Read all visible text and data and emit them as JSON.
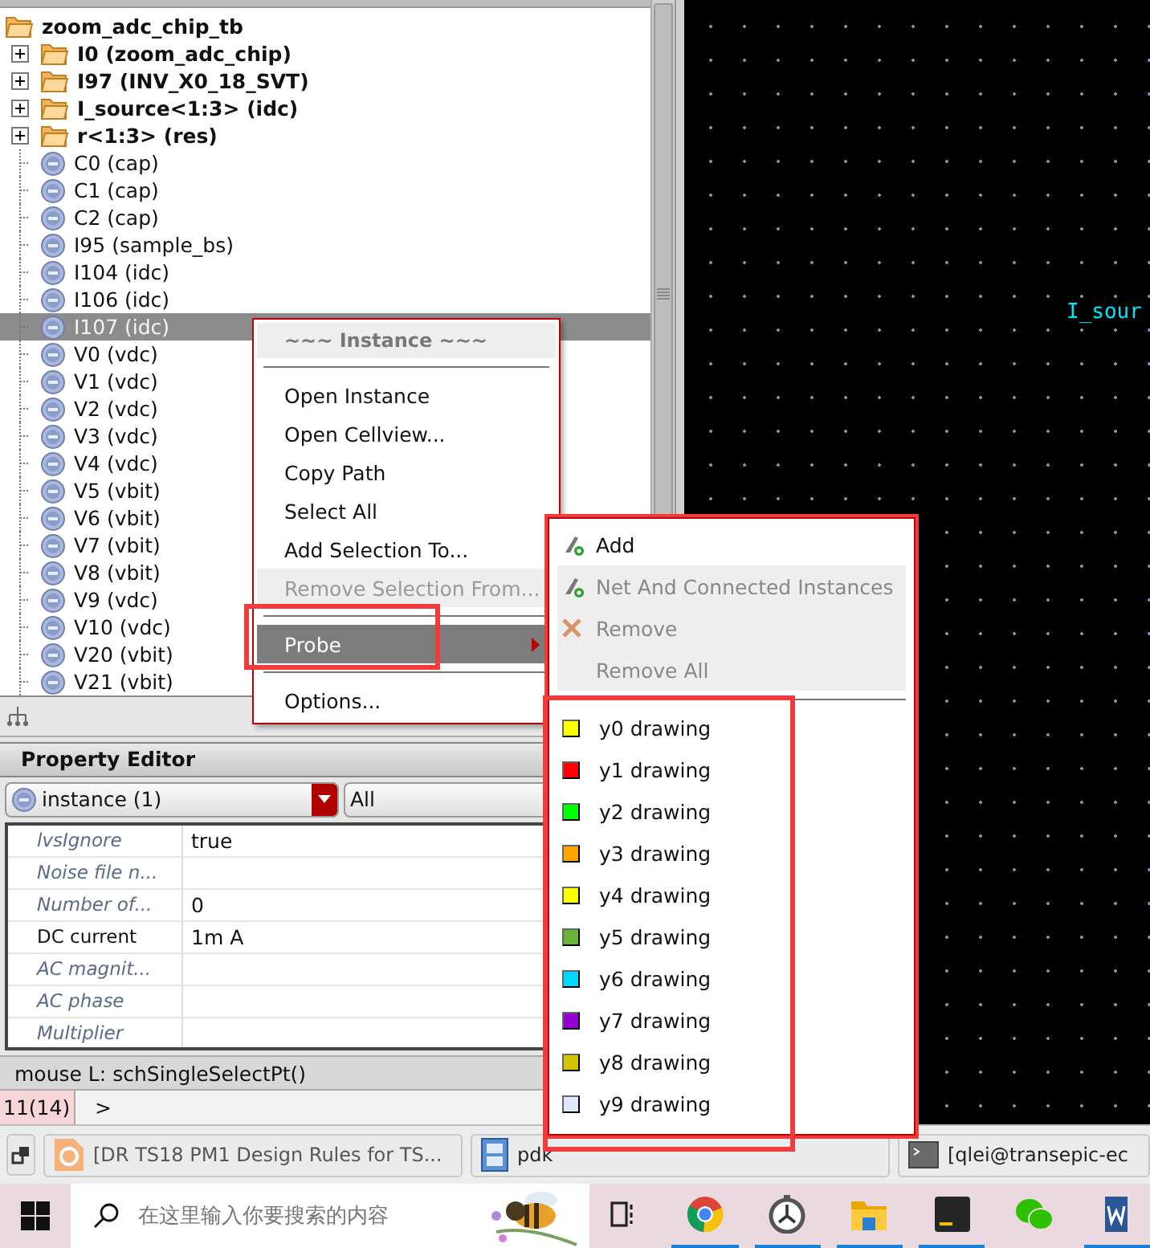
{
  "tree": {
    "root": {
      "label": "zoom_adc_chip_tb",
      "expanded": true,
      "selected": false,
      "children": [
        {
          "label": "I0 (zoom_adc_chip)",
          "kind": "folder",
          "expanded": false,
          "selected": false
        },
        {
          "label": "I97 (INV_X0_18_SVT)",
          "kind": "folder",
          "expanded": false,
          "selected": false
        },
        {
          "label": "I_source<1:3> (idc)",
          "kind": "folder",
          "expanded": false,
          "selected": false
        },
        {
          "label": "r<1:3> (res)",
          "kind": "folder",
          "expanded": false,
          "selected": false
        },
        {
          "label": "C0 (cap)",
          "kind": "instance",
          "selected": false
        },
        {
          "label": "C1 (cap)",
          "kind": "instance",
          "selected": false
        },
        {
          "label": "C2 (cap)",
          "kind": "instance",
          "selected": false
        },
        {
          "label": "I95 (sample_bs)",
          "kind": "instance",
          "selected": false
        },
        {
          "label": "I104 (idc)",
          "kind": "instance",
          "selected": false
        },
        {
          "label": "I106 (idc)",
          "kind": "instance",
          "selected": false
        },
        {
          "label": "I107 (idc)",
          "kind": "instance",
          "selected": true
        },
        {
          "label": "V0 (vdc)",
          "kind": "instance",
          "selected": false
        },
        {
          "label": "V1 (vdc)",
          "kind": "instance",
          "selected": false
        },
        {
          "label": "V2 (vdc)",
          "kind": "instance",
          "selected": false
        },
        {
          "label": "V3 (vdc)",
          "kind": "instance",
          "selected": false
        },
        {
          "label": "V4 (vdc)",
          "kind": "instance",
          "selected": false
        },
        {
          "label": "V5 (vbit)",
          "kind": "instance",
          "selected": false
        },
        {
          "label": "V6 (vbit)",
          "kind": "instance",
          "selected": false
        },
        {
          "label": "V7 (vbit)",
          "kind": "instance",
          "selected": false
        },
        {
          "label": "V8 (vbit)",
          "kind": "instance",
          "selected": false
        },
        {
          "label": "V9 (vdc)",
          "kind": "instance",
          "selected": false
        },
        {
          "label": "V10 (vdc)",
          "kind": "instance",
          "selected": false
        },
        {
          "label": "V20 (vbit)",
          "kind": "instance",
          "selected": false
        },
        {
          "label": "V21 (vbit)",
          "kind": "instance",
          "selected": false
        }
      ]
    }
  },
  "canvas": {
    "labels": [
      {
        "text": "I_sour"
      }
    ]
  },
  "context_menu": {
    "title": "~~~ Instance ~~~",
    "items": [
      {
        "kind": "separator"
      },
      {
        "kind": "item",
        "label": "Open Instance",
        "disabled": false,
        "selected": false
      },
      {
        "kind": "item",
        "label": "Open Cellview...",
        "disabled": false,
        "selected": false
      },
      {
        "kind": "item",
        "label": "Copy Path",
        "disabled": false,
        "selected": false
      },
      {
        "kind": "item",
        "label": "Select All",
        "disabled": false,
        "selected": false
      },
      {
        "kind": "item",
        "label": "Add Selection To...",
        "disabled": false,
        "selected": false
      },
      {
        "kind": "item",
        "label": "Remove Selection From...",
        "disabled": true,
        "selected": false
      },
      {
        "kind": "separator"
      },
      {
        "kind": "submenu",
        "label": "Probe",
        "disabled": false,
        "selected": true,
        "annotated": true
      },
      {
        "kind": "separator"
      },
      {
        "kind": "item",
        "label": "Options...",
        "disabled": false,
        "selected": false
      }
    ]
  },
  "probe_submenu": {
    "annotated": true,
    "actions": [
      {
        "label": "Add",
        "kind": "add",
        "disabled": false
      },
      {
        "label": "Net And Connected Instances",
        "kind": "add",
        "disabled": true
      },
      {
        "label": "Remove",
        "kind": "remove",
        "disabled": true
      },
      {
        "label": "Remove All",
        "kind": "plain",
        "disabled": true
      }
    ],
    "layers_annotated": true,
    "layers": [
      {
        "label": "y0 drawing",
        "color": "#ffff00"
      },
      {
        "label": "y1 drawing",
        "color": "#ff0000"
      },
      {
        "label": "y2 drawing",
        "color": "#00ff00"
      },
      {
        "label": "y3 drawing",
        "color": "#ffa500"
      },
      {
        "label": "y4 drawing",
        "color": "#ffff00"
      },
      {
        "label": "y5 drawing",
        "color": "#6ab23a"
      },
      {
        "label": "y6 drawing",
        "color": "#00d8ff"
      },
      {
        "label": "y7 drawing",
        "color": "#9400d3"
      },
      {
        "label": "y8 drawing",
        "color": "#d4c400"
      },
      {
        "label": "y9 drawing",
        "color": "#dde8ff"
      }
    ]
  },
  "property_editor": {
    "title": "Property Editor",
    "object_select": "instance (1)",
    "filter_select": "All",
    "rows": [
      {
        "name": "lvsIgnore",
        "value": "true",
        "default": true
      },
      {
        "name": "Noise file n...",
        "default": true
      },
      {
        "name": "Number of...",
        "value": "0",
        "default": true
      },
      {
        "name": "DC current",
        "value": "1m A",
        "default": false
      },
      {
        "name": "AC magnit...",
        "default": true
      },
      {
        "name": "AC phase",
        "default": true
      },
      {
        "name": "Multiplier",
        "default": true
      }
    ]
  },
  "status_bar": {
    "mouse": "mouse L: schSingleSelectPt()",
    "command_count": "11(14)",
    "prompt": ">"
  },
  "linux_taskbar": {
    "windows": [
      {
        "title": "[DR TS18 PM1 Design Rules for TS...",
        "kind": "document"
      },
      {
        "title": "pdk",
        "kind": "files"
      },
      {
        "title": "[qlei@transepic-ec",
        "kind": "terminal"
      }
    ]
  },
  "windows_taskbar": {
    "search": {
      "placeholder": "在这里输入你要搜索的内容"
    },
    "apps": [
      {
        "kind": "task-view",
        "running": false
      },
      {
        "kind": "browser",
        "running": true
      },
      {
        "kind": "clock",
        "running": true
      },
      {
        "kind": "folder",
        "running": true
      },
      {
        "kind": "dark",
        "running": true
      },
      {
        "kind": "chat",
        "running": false
      },
      {
        "kind": "document",
        "running": true
      }
    ]
  }
}
